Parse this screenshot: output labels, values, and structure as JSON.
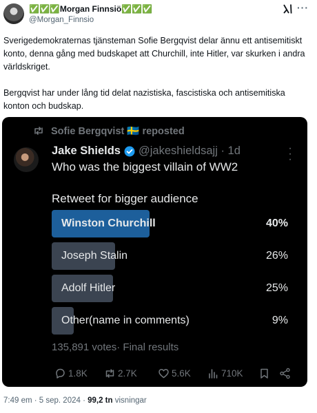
{
  "author": {
    "name": "✅✅✅Morgan Finnsiö✅✅✅",
    "handle": "@Morgan_Finnsio"
  },
  "tweet": {
    "paragraph1": "Sverigedemokraternas tjänsteman Sofie Bergqvist delar ännu ett antisemitiskt konto, denna gång med budskapet att Churchill, inte Hitler, var skurken i andra världskriget.",
    "paragraph2": "Bergqvist har under lång tid delat nazistiska, fascistiska och antisemitiska konton och budskap."
  },
  "quoted": {
    "repost_text": "Sofie Bergqvist 🇸🇪 reposted",
    "name": "Jake Shields",
    "handle_time": "@jakeshieldsajj · 1d",
    "question": "Who was the biggest villain of WW2",
    "subtext": "Retweet for bigger audience",
    "poll": [
      {
        "label": "Winston Churchill",
        "percent_text": "40%",
        "percent": 40,
        "winner": true
      },
      {
        "label": "Joseph Stalin",
        "percent_text": "26%",
        "percent": 26,
        "winner": false
      },
      {
        "label": "Adolf Hitler",
        "percent_text": "25%",
        "percent": 25,
        "winner": false
      },
      {
        "label": "Other(name in comments)",
        "percent_text": "9%",
        "percent": 9,
        "winner": false
      }
    ],
    "poll_footer": "135,891 votes· Final results",
    "actions": {
      "replies": "1.8K",
      "reposts": "2.7K",
      "likes": "5.6K",
      "views": "710K"
    }
  },
  "meta": {
    "time": "7:49 em · 5 sep. 2024 · ",
    "views_count": "99,2 tn",
    "views_label": " visningar"
  },
  "colors": {
    "winner_bar": "#1d5f9b",
    "other_bar": "#3b4451",
    "verified": "#1d9bf0"
  },
  "icons": [
    "grok-icon",
    "more-icon",
    "repost-icon",
    "verified-icon",
    "reply-icon",
    "like-icon",
    "views-icon",
    "bookmark-icon",
    "share-icon"
  ]
}
